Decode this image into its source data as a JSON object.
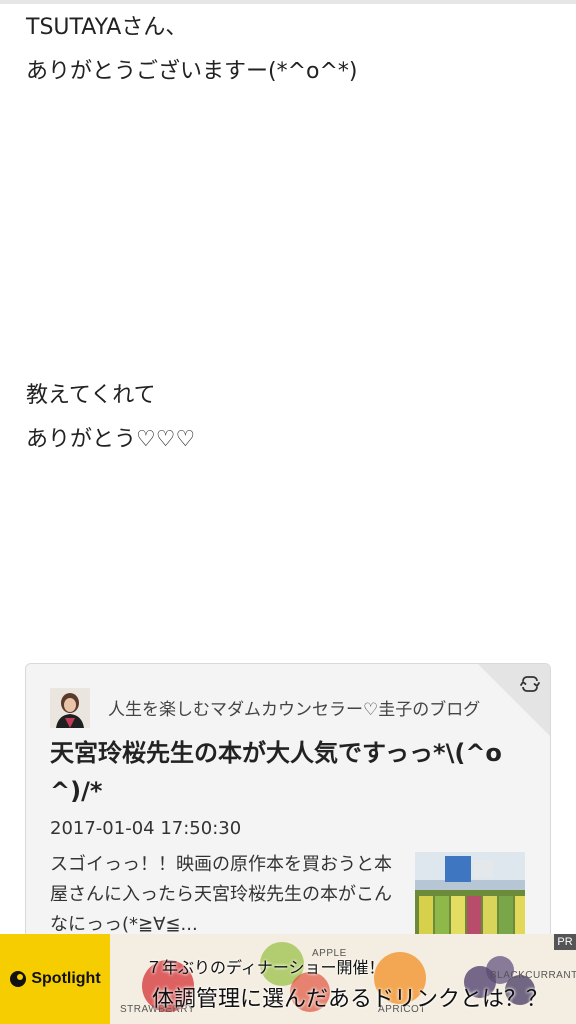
{
  "post": {
    "line1": "TSUTAYAさん、",
    "line2": "ありがとうございますー(*^o^*)",
    "line3": "教えてくれて",
    "line4": "ありがとう♡♡♡"
  },
  "embed_card": {
    "blog_name": "人生を楽しむマダムカウンセラー♡圭子のブログ",
    "title": "天宮玲桜先生の本が大人気ですっっ*\\(^o^)/*",
    "date": "2017-01-04 17:50:30",
    "excerpt": "スゴイっっ！！映画の原作本を買おうと本屋さんに入ったら天宮玲桜先生の本がこんなにっっ(*≧∀≦...",
    "refresh_icon": "refresh-icon"
  },
  "ad": {
    "brand": "Spotlight",
    "line1": "７年ぶりのディナーショー開催！",
    "line2": "体調管理に選んだあるドリンクとは？？",
    "pr_label": "PR",
    "fruit_labels": [
      "STRAWBERRY",
      "APPLE",
      "APRICOT",
      "BLACKCURRANT"
    ]
  }
}
